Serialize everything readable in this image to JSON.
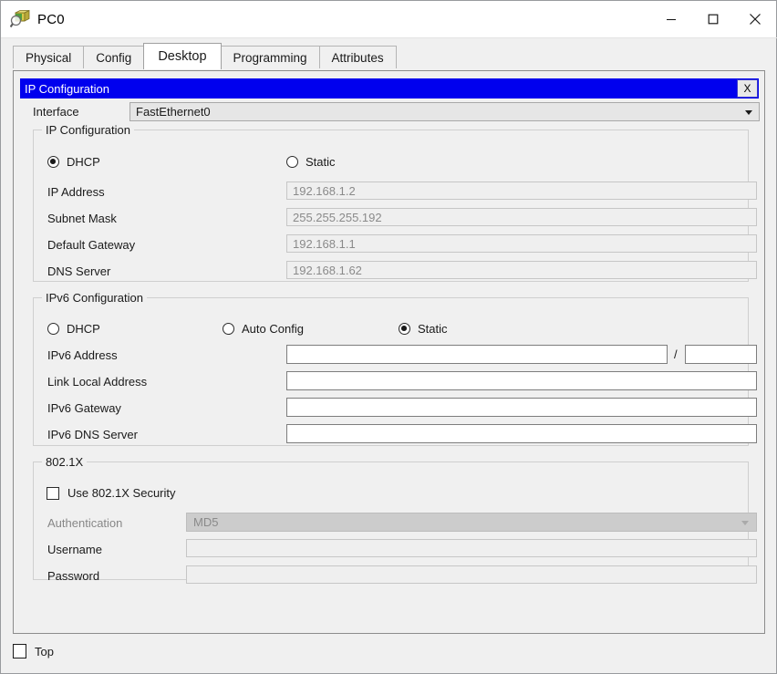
{
  "window": {
    "title": "PC0",
    "icon": "packet-tracer-device-icon",
    "controls": {
      "minimize": "–",
      "maximize": "□",
      "close": "✕"
    }
  },
  "tabs": [
    {
      "label": "Physical",
      "active": false
    },
    {
      "label": "Config",
      "active": false
    },
    {
      "label": "Desktop",
      "active": true
    },
    {
      "label": "Programming",
      "active": false
    },
    {
      "label": "Attributes",
      "active": false
    }
  ],
  "dialog": {
    "title": "IP Configuration",
    "close_label": "X",
    "title_bar_color": "#0000ee",
    "title_text_color": "#ffffff"
  },
  "interface": {
    "label": "Interface",
    "value": "FastEthernet0",
    "options": [
      "FastEthernet0"
    ]
  },
  "ipv4": {
    "group_title": "IP Configuration",
    "mode_dhcp": "DHCP",
    "mode_static": "Static",
    "selected_mode": "DHCP",
    "fields": [
      {
        "label": "IP Address",
        "value": "192.168.1.2",
        "disabled": true
      },
      {
        "label": "Subnet Mask",
        "value": "255.255.255.192",
        "disabled": true
      },
      {
        "label": "Default Gateway",
        "value": "192.168.1.1",
        "disabled": true
      },
      {
        "label": "DNS Server",
        "value": "192.168.1.62",
        "disabled": true
      }
    ]
  },
  "ipv6": {
    "group_title": "IPv6 Configuration",
    "mode_dhcp": "DHCP",
    "mode_auto": "Auto Config",
    "mode_static": "Static",
    "selected_mode": "Static",
    "address_label": "IPv6 Address",
    "address_value": "",
    "prefix_separator": "/",
    "prefix_value": "",
    "fields": [
      {
        "label": "Link Local Address",
        "value": ""
      },
      {
        "label": "IPv6 Gateway",
        "value": ""
      },
      {
        "label": "IPv6 DNS Server",
        "value": ""
      }
    ]
  },
  "dot1x": {
    "group_title": "802.1X",
    "use_security_label": "Use 802.1X Security",
    "use_security_checked": false,
    "auth_label": "Authentication",
    "auth_value": "MD5",
    "username_label": "Username",
    "username_value": "",
    "password_label": "Password",
    "password_value": ""
  },
  "footer": {
    "top_label": "Top",
    "top_checked": false
  }
}
